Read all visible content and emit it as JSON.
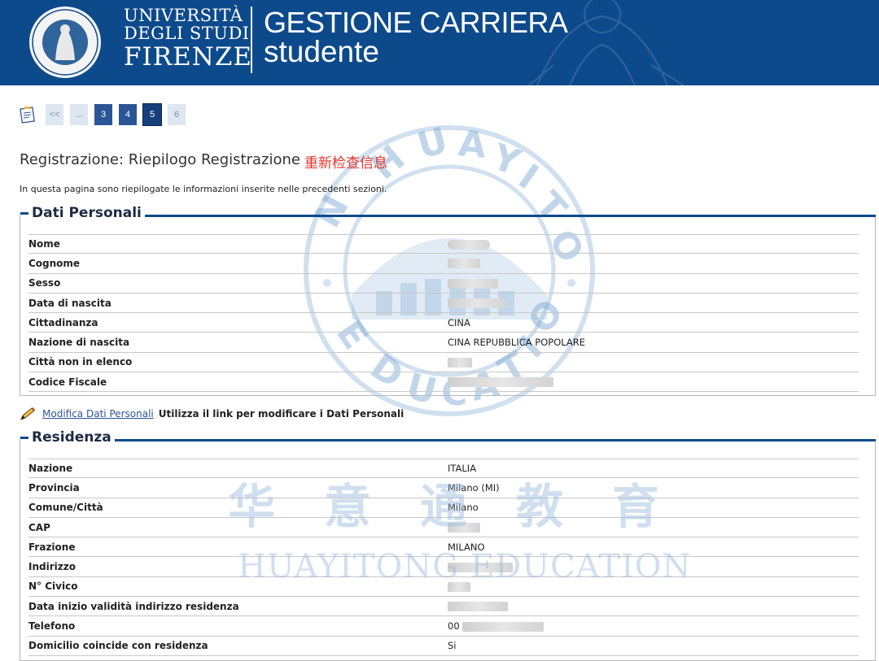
{
  "header": {
    "university_line1": "UNIVERSITÀ",
    "university_line2": "DEGLI STUDI",
    "university_line3": "FIRENZE",
    "app_line1": "GESTIONE CARRIERA",
    "app_line2": "studente",
    "brand_color": "#0d4a8c"
  },
  "pager": {
    "items": [
      {
        "label": "<<",
        "state": "light"
      },
      {
        "label": "...",
        "state": "light"
      },
      {
        "label": "3",
        "state": "dark"
      },
      {
        "label": "4",
        "state": "dark"
      },
      {
        "label": "5",
        "state": "current"
      },
      {
        "label": "6",
        "state": "light"
      }
    ]
  },
  "page": {
    "title": "Registrazione: Riepilogo Registrazione",
    "red_note": "重新检查信息",
    "intro": "In questa pagina sono riepilogate le informazioni inserite nelle precedenti sezioni."
  },
  "dati_personali": {
    "legend": "Dati Personali",
    "rows": [
      {
        "label": "Nome",
        "value": ""
      },
      {
        "label": "Cognome",
        "value": ""
      },
      {
        "label": "Sesso",
        "value": ""
      },
      {
        "label": "Data di nascita",
        "value": ""
      },
      {
        "label": "Cittadinanza",
        "value": "CINA"
      },
      {
        "label": "Nazione di nascita",
        "value": "CINA REPUBBLICA POPOLARE"
      },
      {
        "label": "Città non in elenco",
        "value": ""
      },
      {
        "label": "Codice Fiscale",
        "value": ""
      }
    ]
  },
  "modifica": {
    "link": "Modifica Dati Personali",
    "text": "Utilizza il link per modificare i Dati Personali"
  },
  "residenza": {
    "legend": "Residenza",
    "rows": [
      {
        "label": "Nazione",
        "value": "ITALIA"
      },
      {
        "label": "Provincia",
        "value": "Milano (MI)"
      },
      {
        "label": "Comune/Città",
        "value": "Milano"
      },
      {
        "label": "CAP",
        "value": ""
      },
      {
        "label": "Frazione",
        "value": "MILANO"
      },
      {
        "label": "Indirizzo",
        "value": ""
      },
      {
        "label": "N° Civico",
        "value": ""
      },
      {
        "label": "Data inizio validità indirizzo residenza",
        "value": ""
      },
      {
        "label": "Telefono",
        "value": "00"
      },
      {
        "label": "Domicilio coincide con residenza",
        "value": "Si"
      }
    ]
  },
  "watermark": {
    "chinese": "华意通教育",
    "english": "HUAYITONG EDUCATION"
  }
}
